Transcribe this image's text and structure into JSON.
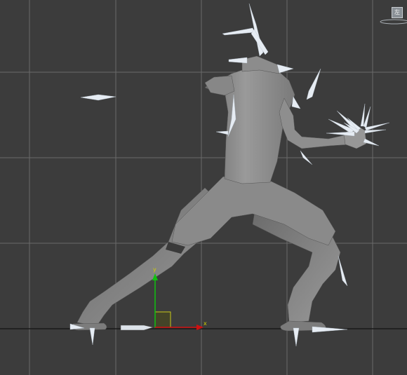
{
  "viewport": {
    "type": "3d-orthographic-viewport",
    "background": "#3c3c3c",
    "grid_color": "#6a6a6a",
    "ground_line_color": "#1a1a1a",
    "model_color": "#8e8e8e",
    "spike_color": "#e8eef5"
  },
  "gizmo": {
    "x_label": "x",
    "y_label": "y",
    "x_color": "#d01010",
    "y_color": "#10c010",
    "plane_color": "#c8c81a"
  },
  "viewcube": {
    "label": "左",
    "icon": "viewcube-icon"
  }
}
